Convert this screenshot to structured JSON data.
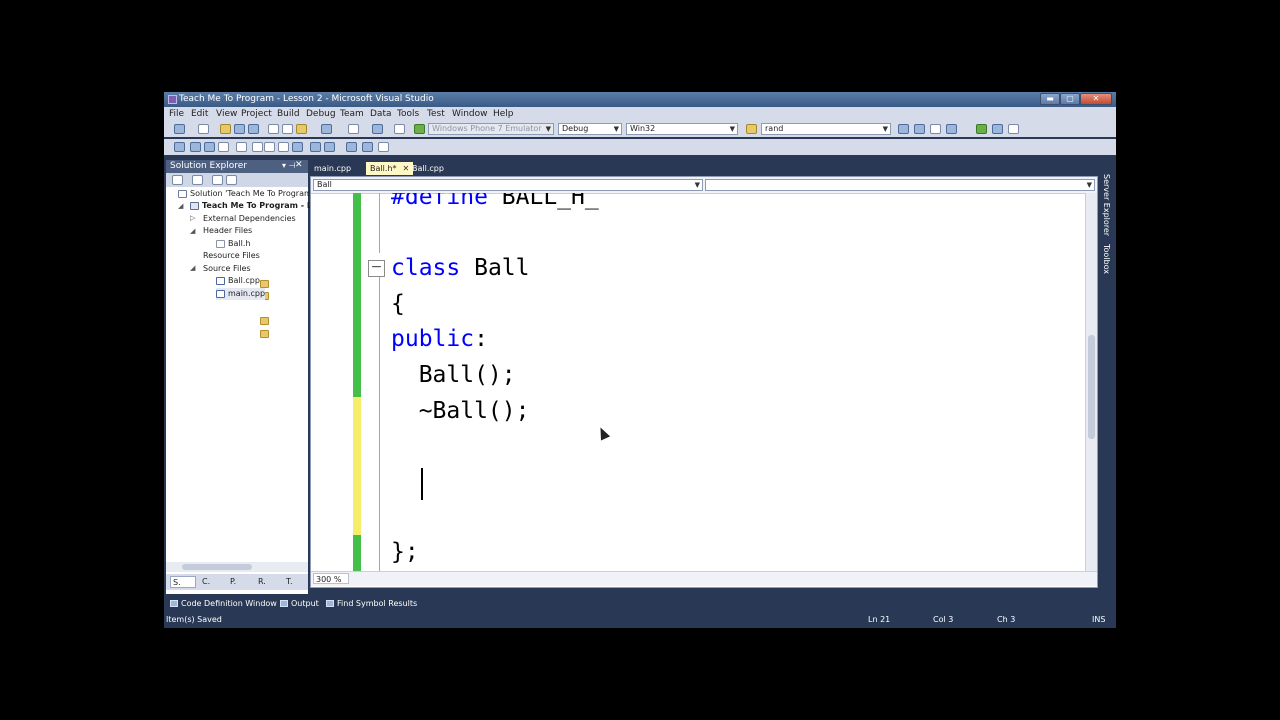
{
  "window": {
    "title": "Teach Me To Program - Lesson 2 - Microsoft Visual Studio",
    "min_label": "▬",
    "max_label": "▢",
    "close_label": "✕"
  },
  "menu": [
    "File",
    "Edit",
    "View",
    "Project",
    "Build",
    "Debug",
    "Team",
    "Data",
    "Tools",
    "Test",
    "Window",
    "Help"
  ],
  "toolbar": {
    "target_combo": "Windows Phone 7 Emulator",
    "config_combo": "Debug",
    "platform_combo": "Win32",
    "find_combo": "rand"
  },
  "solution_explorer": {
    "title": "Solution Explorer",
    "pin": "▾ ⊣",
    "close": "✕",
    "tree": [
      {
        "label": "Solution 'Teach Me To Program",
        "icon": "solution-icon"
      },
      {
        "label": "Teach Me To Program - Le",
        "icon": "project-icon"
      },
      {
        "label": "External Dependencies",
        "icon": "folder-icon"
      },
      {
        "label": "Header Files",
        "icon": "folder-icon"
      },
      {
        "label": "Ball.h",
        "icon": "header-file-icon"
      },
      {
        "label": "Resource Files",
        "icon": "folder-icon"
      },
      {
        "label": "Source Files",
        "icon": "folder-icon"
      },
      {
        "label": "Ball.cpp",
        "icon": "cpp-file-icon"
      },
      {
        "label": "main.cpp",
        "icon": "cpp-file-icon"
      }
    ],
    "tabs": [
      "S.",
      "C.",
      "P.",
      "R.",
      "T."
    ]
  },
  "editor": {
    "tabs": [
      {
        "label": "main.cpp"
      },
      {
        "label": "Ball.h*",
        "close": "✕"
      },
      {
        "label": "Ball.cpp"
      }
    ],
    "nav_left": "Ball",
    "code_lines": [
      "#define BALL_H_",
      "",
      "class Ball",
      "{",
      "public:",
      "  Ball();",
      "  ~Ball();",
      "",
      "",
      "",
      "};"
    ],
    "zoom": "300 %"
  },
  "side_strip": [
    "Server Explorer",
    "Toolbox"
  ],
  "bottom_tabs": [
    "Code Definition Window",
    "Output",
    "Find Symbol Results"
  ],
  "status": {
    "message": "Item(s) Saved",
    "ln": "Ln 21",
    "col": "Col 3",
    "ch": "Ch 3",
    "mode": "INS"
  }
}
